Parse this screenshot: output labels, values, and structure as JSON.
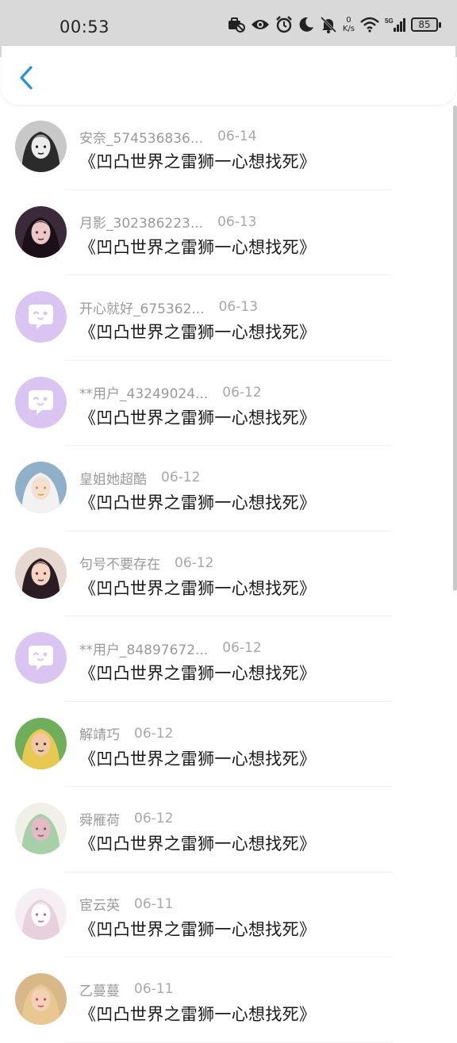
{
  "status_bar": {
    "time": "00:53",
    "netspeed_value": "0",
    "netspeed_unit": "K/s",
    "network": "5G",
    "battery": "85",
    "icons": [
      "work-badge-icon",
      "eye-icon",
      "alarm-icon",
      "moon-icon",
      "bell-off-icon",
      "wifi-icon",
      "signal-icon",
      "battery-icon"
    ]
  },
  "header": {
    "back_icon": "chevron-left-icon",
    "accent_color": "#2a8fe0"
  },
  "items": [
    {
      "username": "安奈_574536836...",
      "date": "06-14",
      "message": "《凹凸世界之雷狮一心想找死》",
      "avatar": "photo-dark-hair-girl"
    },
    {
      "username": "月影_302386223...",
      "date": "06-13",
      "message": "《凹凸世界之雷狮一心想找死》",
      "avatar": "photo-dark-girl"
    },
    {
      "username": "开心就好_675362...",
      "date": "06-13",
      "message": "《凹凸世界之雷狮一心想找死》",
      "avatar": "default-chat-avatar"
    },
    {
      "username": "**用户_43249024...",
      "date": "06-12",
      "message": "《凹凸世界之雷狮一心想找死》",
      "avatar": "default-chat-avatar"
    },
    {
      "username": "皇姐她超酷",
      "date": "06-12",
      "message": "《凹凸世界之雷狮一心想找死》",
      "avatar": "photo-white-hair-anime"
    },
    {
      "username": "句号不要存在",
      "date": "06-12",
      "message": "《凹凸世界之雷狮一心想找死》",
      "avatar": "photo-anime-boy"
    },
    {
      "username": "**用户_84897672...",
      "date": "06-12",
      "message": "《凹凸世界之雷狮一心想找死》",
      "avatar": "default-chat-avatar"
    },
    {
      "username": "解靖巧",
      "date": "06-12",
      "message": "《凹凸世界之雷狮一心想找死》",
      "avatar": "photo-child-yellow"
    },
    {
      "username": "舜雁荷",
      "date": "06-12",
      "message": "《凹凸世界之雷狮一心想找死》",
      "avatar": "photo-bottles-green"
    },
    {
      "username": "宦云英",
      "date": "06-11",
      "message": "《凹凸世界之雷狮一心想找死》",
      "avatar": "photo-fox-mask"
    },
    {
      "username": "乙蔓蔓",
      "date": "06-11",
      "message": "《凹凸世界之雷狮一心想找死》",
      "avatar": "photo-blonde-girl"
    }
  ],
  "colors": {
    "default_avatar_bg": "#d9c4f2",
    "default_avatar_fg": "#ffffff",
    "username_color": "#9a9a9a",
    "message_color": "#1a1a1a"
  }
}
